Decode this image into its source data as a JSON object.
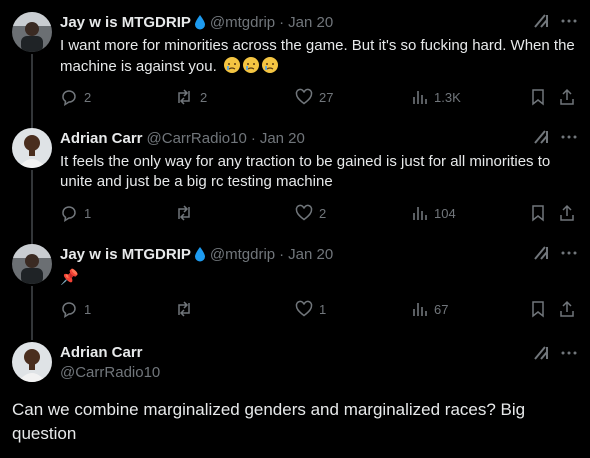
{
  "colors": {
    "background": "#000000",
    "text": "#e7e9ea",
    "muted": "#71767b",
    "thread_line": "#333639",
    "verified_drop": "#1d9bf0"
  },
  "tweets": [
    {
      "name": "Jay w is MTGDRIP",
      "handle": "@mtgdrip",
      "date": "Jan 20",
      "text": "I want more for minorities across the game. But it's so fucking hard. When the machine is against you.",
      "emojis": [
        "crying-face",
        "crying-face",
        "crying-face"
      ],
      "replies": "2",
      "reposts": "2",
      "likes": "27",
      "views": "1.3K"
    },
    {
      "name": "Adrian Carr",
      "handle": "@CarrRadio10",
      "date": "Jan 20",
      "text": "It feels the only way for any traction to be gained is just for all minorities to unite and just be a big rc testing machine",
      "replies": "1",
      "reposts": "",
      "likes": "2",
      "views": "104"
    },
    {
      "name": "Jay w is MTGDRIP",
      "handle": "@mtgdrip",
      "date": "Jan 20",
      "text": "📌",
      "replies": "1",
      "reposts": "",
      "likes": "1",
      "views": "67"
    }
  ],
  "main_tweet": {
    "name": "Adrian Carr",
    "handle": "@CarrRadio10",
    "text": "Can we combine marginalized genders and marginalized races? Big question"
  },
  "separator": "·"
}
